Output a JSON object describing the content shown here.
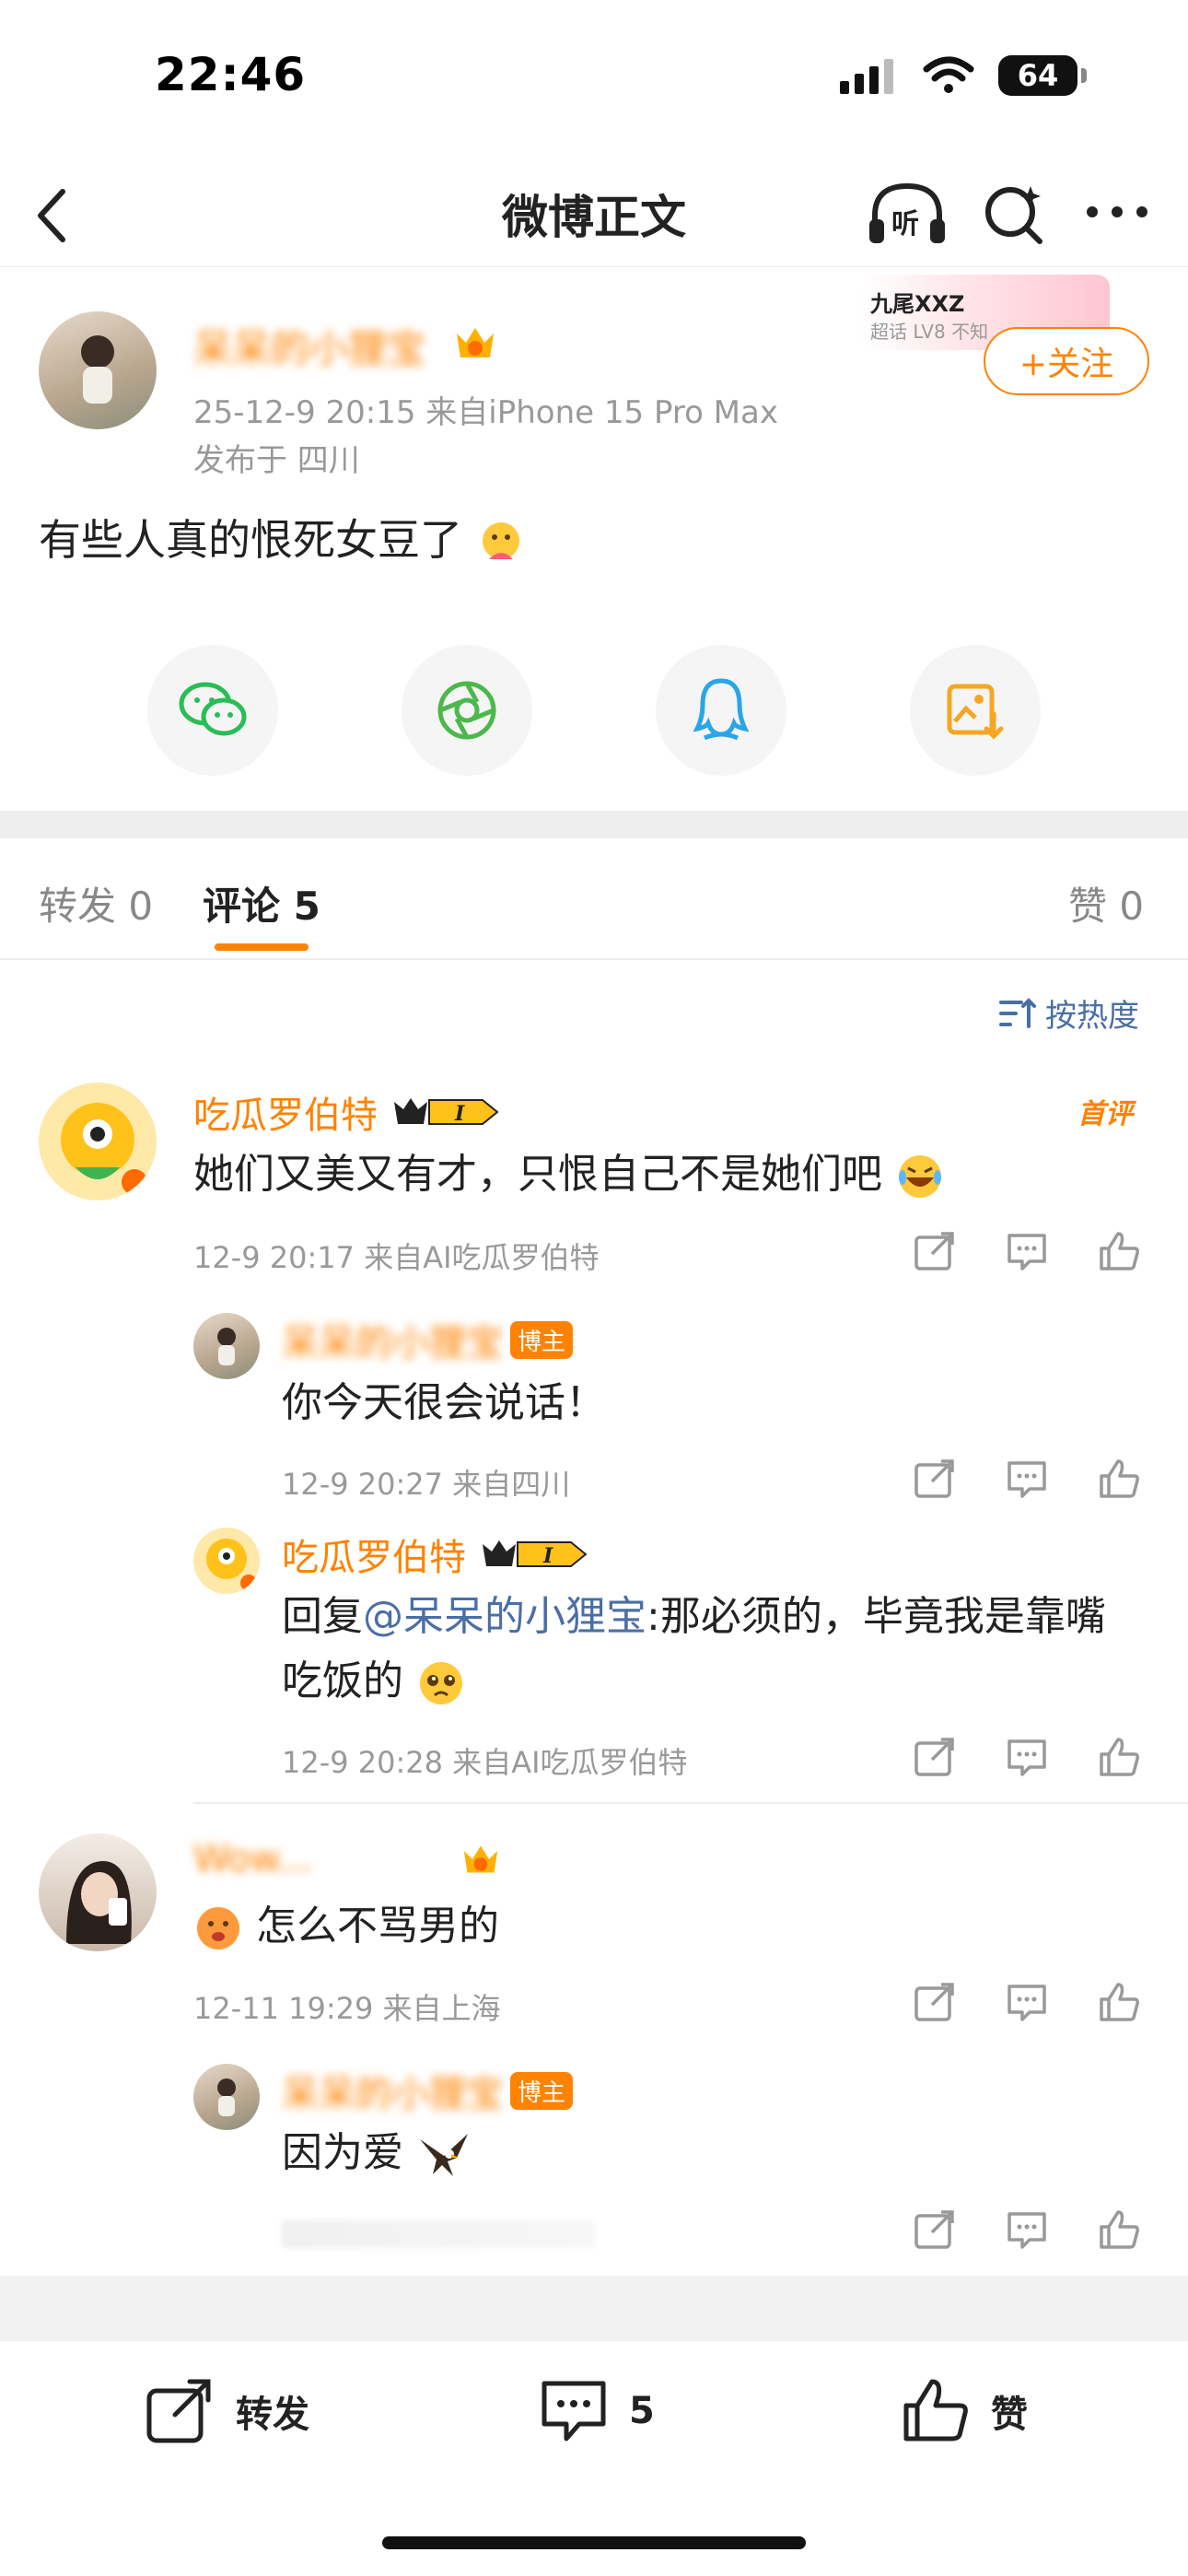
{
  "status": {
    "time": "22:46",
    "battery": "64"
  },
  "nav": {
    "title": "微博正文",
    "listen_label": "听"
  },
  "post": {
    "author": "呆呆的小狸宝",
    "meta": "25-12-9 20:15  来自iPhone 15 Pro Max",
    "location": "发布于 四川",
    "text": "有些人真的恨死女豆了",
    "follow_label": "+关注",
    "badge_title": "九尾XXZ",
    "badge_sub": "超话 LV8 不知"
  },
  "tabs": {
    "repost": "转发 0",
    "comment": "评论 5",
    "like": "赞 0"
  },
  "sort_label": "按热度",
  "comments": [
    {
      "name": "吃瓜罗伯特",
      "tag": "首评",
      "vip": "I",
      "text": "她们又美又有才，只恨自己不是她们吧",
      "meta": "12-9 20:17  来自AI吃瓜罗伯特",
      "replies": [
        {
          "name": "呆呆的小狸宝",
          "badge": "博主",
          "text": "你今天很会说话！",
          "meta": "12-9 20:27  来自四川"
        },
        {
          "name": "吃瓜罗伯特",
          "vip": "I",
          "reply_prefix": "回复",
          "mention": "@呆呆的小狸宝",
          "text": ":那必须的，毕竟我是靠嘴吃饭的",
          "meta": "12-9 20:28  来自AI吃瓜罗伯特"
        }
      ]
    },
    {
      "name": "Wow...",
      "text": "怎么不骂男的",
      "meta": "12-11 19:29  来自上海",
      "replies": [
        {
          "name": "呆呆的小狸宝",
          "badge": "博主",
          "text": "因为爱"
        }
      ]
    }
  ],
  "bottom_bar": {
    "repost": "转发",
    "comment_count": "5",
    "like": "赞"
  },
  "colors": {
    "accent": "#ff8200",
    "link": "#4a6fa5",
    "meta": "#999999"
  }
}
